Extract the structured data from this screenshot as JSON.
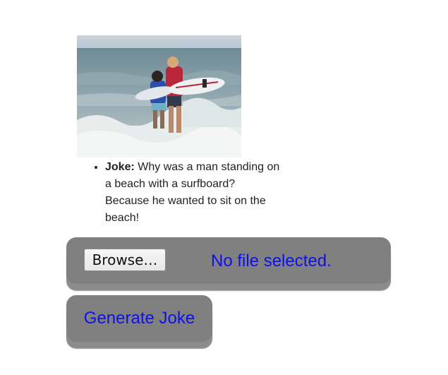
{
  "photo": {
    "subject": "two surfers carrying surfboards into the ocean waves"
  },
  "joke": {
    "label": "Joke:",
    "text": " Why was a man standing on a beach with a surfboard? Because he wanted to sit on the beach!"
  },
  "upload": {
    "browse_label": "Browse…",
    "status_text": "No file selected."
  },
  "actions": {
    "generate_label": "Generate Joke"
  },
  "colors": {
    "panel": "#808080",
    "link_text": "#1010ee"
  }
}
